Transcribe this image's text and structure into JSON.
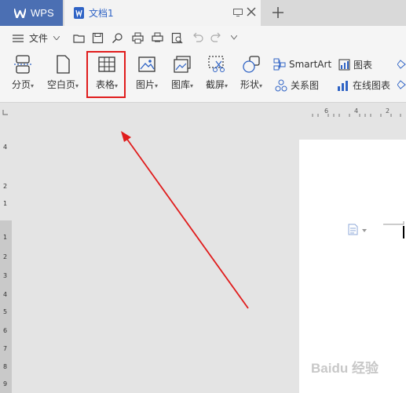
{
  "title_bar": {
    "app_tab_label": "WPS",
    "doc_tab_label": "文档1"
  },
  "menu": {
    "file_label": "文件"
  },
  "toolbar": {
    "page_break": "分页",
    "blank_page": "空白页",
    "table": "表格",
    "picture": "图片",
    "gallery": "图库",
    "screenshot": "截屏",
    "shapes": "形状",
    "smartart": "SmartArt",
    "relation_chart": "关系图",
    "chart": "图表",
    "online_chart": "在线图表"
  },
  "ruler": {
    "top_ticks": [
      "6",
      "4",
      "2"
    ],
    "left_numbers": [
      "4",
      "2",
      "1",
      "1",
      "2",
      "3",
      "4",
      "5",
      "6",
      "7",
      "8",
      "9"
    ]
  },
  "watermark": "Baidu 经验",
  "colors": {
    "wps_tab": "#4b6fb3",
    "highlight": "#e01c1c",
    "arrow": "#e01c1c",
    "doc_blue": "#2f63c5"
  }
}
